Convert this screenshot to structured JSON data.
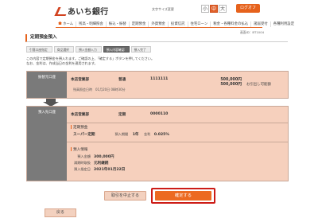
{
  "header": {
    "logo_text": "あいち銀行",
    "fontsize_label": "文字サイズ変更",
    "fontsize_buttons": [
      "小",
      "中",
      "大"
    ],
    "logout_label": "ログオフ"
  },
  "nav": {
    "items": [
      "ホーム",
      "残高・明細照会",
      "振込・振替",
      "定期預金",
      "外貨預金",
      "投資信託",
      "住宅ローン",
      "税金・各種料金の払込",
      "諸届受付",
      "各種利用設定"
    ]
  },
  "screen_id": "画面ID：BT1004",
  "page_title": "定期預金預入",
  "steps": [
    "引落口座指定",
    "商品選択",
    "預入金額入力",
    "預入内容確認",
    "預入完了"
  ],
  "intro": [
    "この内容で定期預金を預入れます。ご確認の上、「確定する」ボタンを押してください。",
    "なお、金利は、作成当日の金利を適用されます。"
  ],
  "withdrawal": {
    "label": "振替元口座",
    "branch": "本店営業部",
    "type": "普通",
    "number": "1111111",
    "amount": "500,000円",
    "balance": "500,000円",
    "balance_note": "お引出し可能額",
    "timestamp": "残高照会日時　01月20日 08時30分"
  },
  "deposit": {
    "label": "預入先口座",
    "branch": "本店営業部",
    "type": "定期",
    "number": "0000110",
    "product_heading": "定期預金",
    "product_name": "スーパー定期",
    "term_label": "預入期間",
    "term_value": "1年",
    "rate_label": "金利",
    "rate_value": "0.025%",
    "info_heading": "預入情報",
    "amount_label": "預入金額",
    "amount_value": "300,000円",
    "maturity_label": "満期時取扱",
    "maturity_value": "元利継続",
    "date_label": "預入指定日",
    "date_value": "2021年01月22日"
  },
  "buttons": {
    "cancel": "取引を中止する",
    "confirm": "確定する",
    "back": "戻る"
  }
}
